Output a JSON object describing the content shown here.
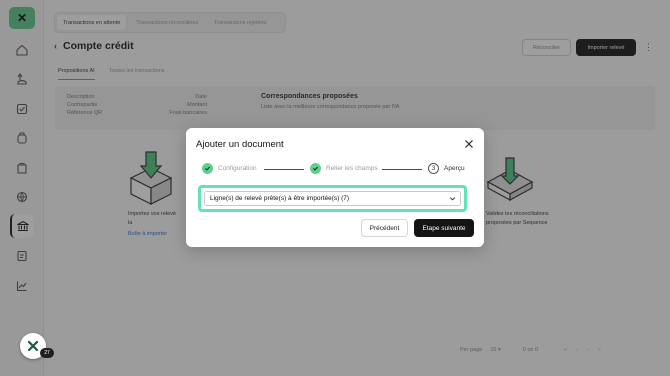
{
  "tabs_top": [
    {
      "label": "Transactions en attente",
      "selected": true
    },
    {
      "label": "Transactions réconciliées",
      "selected": false
    },
    {
      "label": "Transactions rejetées",
      "selected": false
    }
  ],
  "header": {
    "title": "Compte crédit",
    "reconcile_label": "Réconcilier",
    "import_label": "Importer relevé"
  },
  "subtabs": [
    {
      "label": "Propositions AI",
      "selected": true
    },
    {
      "label": "Toutes les transactions",
      "selected": false
    }
  ],
  "table_header": {
    "left_lines": [
      "Description",
      "Contrepartie",
      "Référence QR"
    ],
    "right_lines": [
      "Date",
      "Montant",
      "Frais bancaires"
    ],
    "title": "Correspondances proposées",
    "subtitle": "Liste avec la meilleure correspondance proposée par l'IA"
  },
  "empty_left": {
    "text_line1": "Importez vos relevé",
    "text_line2": "la",
    "link": "Boîte à importer"
  },
  "empty_right": {
    "text_line1": "Validez les réconciliations",
    "text_line2": "proposées par Sequence"
  },
  "pager": {
    "per_page_label": "Per page",
    "per_page_value": "10",
    "range": "0 on 0"
  },
  "chat": {
    "count": "27"
  },
  "modal": {
    "title": "Ajouter un document",
    "steps": [
      {
        "label": "Configuration",
        "state": "done"
      },
      {
        "label": "Relier les champs",
        "state": "done"
      },
      {
        "label": "Aperçu",
        "state": "current",
        "number": "3"
      }
    ],
    "select_value": "Ligne(s) de relevé prête(s) à être importée(s) (7)",
    "prev_label": "Précédent",
    "next_label": "Etape suivante"
  },
  "colors": {
    "accent_green": "#5ed08e",
    "highlight_outline": "#62e3b6",
    "primary_button": "#141414"
  }
}
